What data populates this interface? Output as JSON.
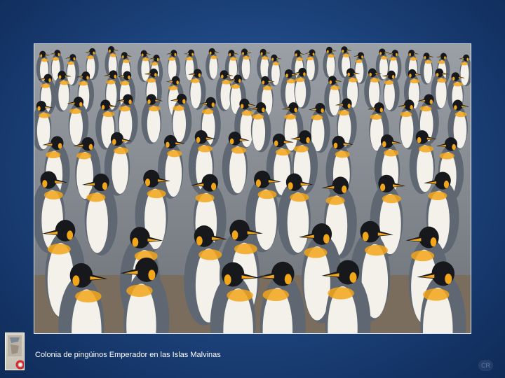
{
  "slide": {
    "caption": "Colonia de pingüinos Emperador en las Islas Malvinas",
    "corner_mark": "CR",
    "photo_icon": "penguin-colony-photo",
    "badge_icon": "lifebuoy-logo-icon"
  },
  "colors": {
    "background": "#1f4782",
    "caption_text": "#ffffff",
    "penguin_back": "#5e6772",
    "penguin_belly": "#f3f1ea",
    "penguin_head": "#16181b",
    "penguin_accent": "#f2a61a"
  }
}
